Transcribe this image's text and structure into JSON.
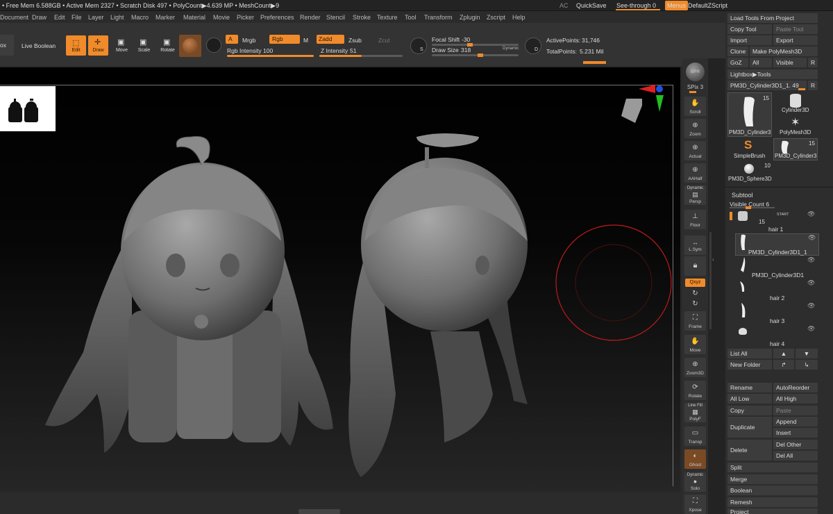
{
  "titlebar": {
    "status": "• Free Mem 6.588GB • Active Mem 2327 • Scratch Disk 497 • PolyCount▶4.639 MP • MeshCount▶9",
    "ac": "AC",
    "quicksave": "QuickSave",
    "see_through_label": "See-through",
    "see_through_value": "0",
    "menus": "Menus",
    "script": "DefaultZScript"
  },
  "menu": {
    "items": [
      "Document",
      "Draw",
      "Edit",
      "File",
      "Layer",
      "Light",
      "Macro",
      "Marker",
      "Material",
      "Movie",
      "Picker",
      "Preferences",
      "Render",
      "Stencil",
      "Stroke",
      "Texture",
      "Tool",
      "Transform",
      "Zplugin",
      "Zscript",
      "Help"
    ]
  },
  "shelf": {
    "ox": "ox",
    "live_boolean": "Live Boolean",
    "edit": "Edit",
    "draw": "Draw",
    "move": "Move",
    "scale": "Scale",
    "rotate": "Rotate",
    "a": "A",
    "mrgb": "Mrgb",
    "rgb": "Rgb",
    "m": "M",
    "rgb_intensity_label": "Rgb Intensity",
    "rgb_intensity": "100",
    "rgb_intensity_level": 1.0,
    "zadd": "Zadd",
    "zsub": "Zsub",
    "zcut": "Zcut",
    "z_intensity_label": "Z Intensity",
    "z_intensity": "51",
    "z_intensity_level": 0.51,
    "focal_shift_label": "Focal Shift",
    "focal_shift": "-30",
    "draw_size_label": "Draw Size",
    "draw_size": "318",
    "dynamic": "Dynamic",
    "s_key": "S",
    "d_key": "D",
    "active_points_label": "ActivePoints:",
    "active_points": "31,746",
    "total_points_label": "TotalPoints:",
    "total_points": "5.231 Mil"
  },
  "right_shelf": {
    "bpr": "BPR",
    "spix_label": "SPix",
    "spix": "3",
    "scroll": "Scroll",
    "zoom": "Zoom",
    "actual": "Actual",
    "aahalf": "AAHalf",
    "dynamic_persp": "Dynamic",
    "persp": "Persp",
    "floor": "Floor",
    "lsym": "L.Sym",
    "xyz": "Qxyz",
    "frame": "Frame",
    "move": "Move",
    "zoom3d": "Zoom3D",
    "rotate": "Rotate",
    "line_fill": "Line Fill",
    "polyf": "PolyF",
    "transp": "Transp",
    "ghost": "Ghost",
    "dynamic_solo": "Dynamic",
    "solo": "Solo",
    "xpose": "Xpose"
  },
  "tool_palette": {
    "load_tools": "Load Tools From Project",
    "copy_tool": "Copy Tool",
    "paste_tool": "Paste Tool",
    "import": "Import",
    "export": "Export",
    "clone": "Clone",
    "make_polymesh": "Make PolyMesh3D",
    "goz": "GoZ",
    "all": "All",
    "visible": "Visible",
    "r": "R",
    "lightbox_tools": "Lightbox▶Tools",
    "current_tool": "PM3D_Cylinder3D1_1. 49",
    "r2": "R",
    "tools": [
      {
        "name": "PM3D_Cylinder3",
        "count": "15"
      },
      {
        "name": "Cylinder3D",
        "count": ""
      },
      {
        "name": "PolyMesh3D",
        "count": ""
      },
      {
        "name": "SimpleBrush",
        "count": ""
      },
      {
        "name": "PM3D_Cylinder3",
        "count": "15"
      },
      {
        "name": "PM3D_Sphere3D",
        "count": "10"
      }
    ]
  },
  "subtool": {
    "header": "Subtool",
    "visible_count_label": "Visible Count",
    "visible_count": "6",
    "start": "START",
    "items": [
      {
        "name": "hair 1",
        "sub": "15"
      },
      {
        "name": "PM3D_Cylinder3D1_1",
        "sub": ""
      },
      {
        "name": "PM3D_Cylinder3D1",
        "sub": ""
      },
      {
        "name": "hair 2",
        "sub": ""
      },
      {
        "name": "hair 3",
        "sub": ""
      },
      {
        "name": "hair 4",
        "sub": ""
      }
    ],
    "list_all": "List All",
    "new_folder": "New Folder",
    "rename": "Rename",
    "autoreorder": "AutoReorder",
    "all_low": "All Low",
    "all_high": "All High",
    "copy": "Copy",
    "paste": "Paste",
    "duplicate": "Duplicate",
    "append": "Append",
    "insert": "Insert",
    "delete": "Delete",
    "del_other": "Del Other",
    "del_all": "Del All",
    "split": "Split",
    "merge": "Merge",
    "boolean": "Boolean",
    "remesh": "Remesh",
    "project": "Project"
  },
  "colors": {
    "accent": "#f08b2b",
    "panel": "#2d2d2d",
    "brush_ring": "#c21a1a"
  }
}
